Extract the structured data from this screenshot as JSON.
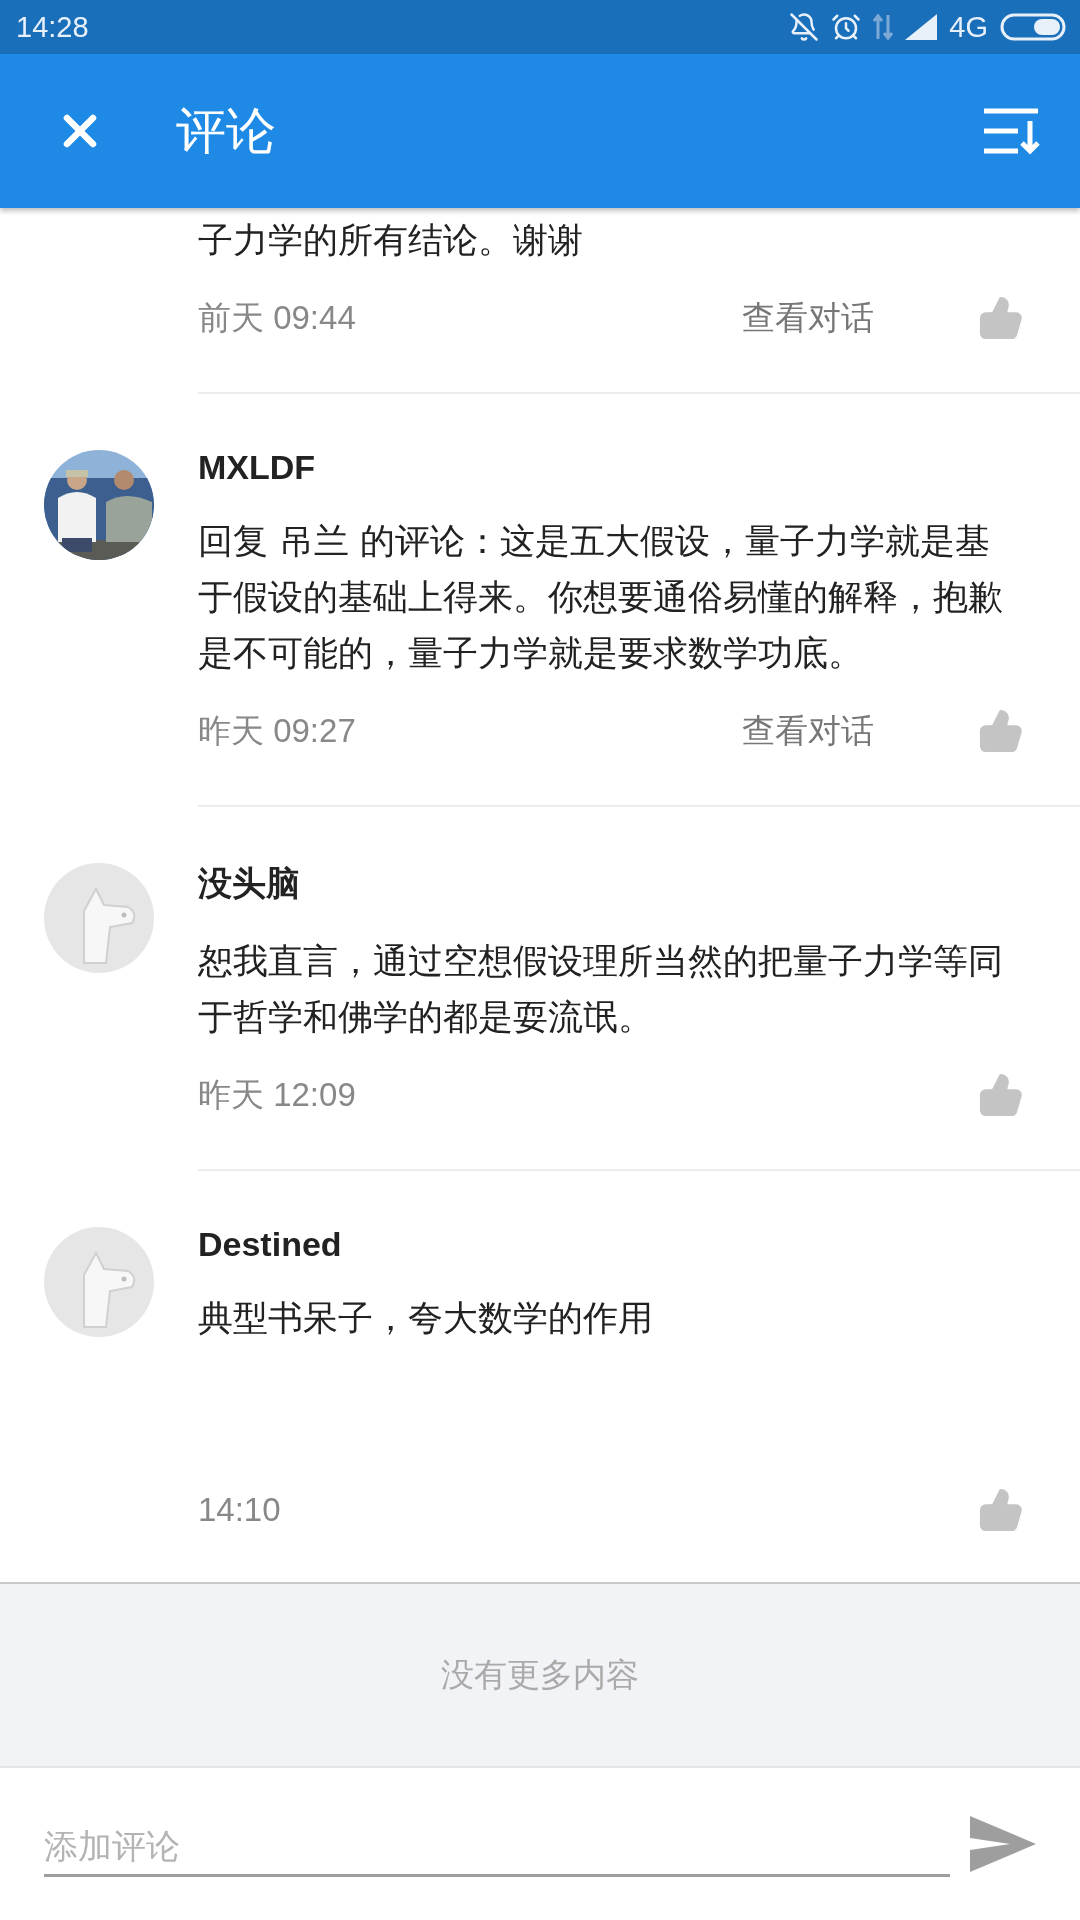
{
  "status_bar": {
    "time": "14:28",
    "network": "4G"
  },
  "app_bar": {
    "title": "评论"
  },
  "comments": [
    {
      "text": "子力学的所有结论。谢谢",
      "time": "前天 09:44",
      "view_conversation": "查看对话"
    },
    {
      "name": "MXLDF",
      "text": "回复 吊兰 的评论：这是五大假设，量子力学就是基于假设的基础上得来。你想要通俗易懂的解释，抱歉是不可能的，量子力学就是要求数学功底。",
      "time": "昨天 09:27",
      "view_conversation": "查看对话"
    },
    {
      "avatar": {
        "kind": "default"
      },
      "name": "没头脑",
      "text": "恕我直言，通过空想假设理所当然的把量子力学等同于哲学和佛学的都是耍流氓。",
      "time": "昨天 12:09"
    },
    {
      "avatar": {
        "kind": "default"
      },
      "name": "Destined",
      "text": "典型书呆子，夸大数学的作用",
      "time": "14:10"
    }
  ],
  "end_message": "没有更多内容",
  "comment_input": {
    "placeholder": "添加评论"
  }
}
